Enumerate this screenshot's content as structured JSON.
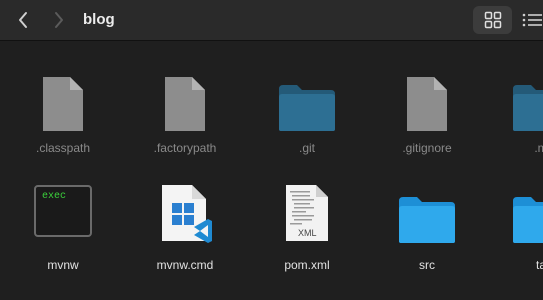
{
  "toolbar": {
    "title": "blog",
    "back_icon": "chevron-left-icon",
    "forward_icon": "chevron-right-icon",
    "grid_view_icon": "grid-view-icon",
    "list_view_icon": "list-view-icon"
  },
  "files": {
    "row1": [
      {
        "name": ".classpath",
        "icon": "document-icon"
      },
      {
        "name": ".factorypath",
        "icon": "document-icon"
      },
      {
        "name": ".git",
        "icon": "folder-icon"
      },
      {
        "name": ".gitignore",
        "icon": "document-icon"
      },
      {
        "name": ".m",
        "icon": "folder-icon"
      }
    ],
    "row2": [
      {
        "name": "mvnw",
        "icon": "terminal-exec-icon",
        "badge_text": "exec"
      },
      {
        "name": "mvnw.cmd",
        "icon": "vscode-file-icon"
      },
      {
        "name": "pom.xml",
        "icon": "xml-file-icon",
        "badge_text": "XML"
      },
      {
        "name": "src",
        "icon": "folder-icon"
      },
      {
        "name": "ta",
        "icon": "folder-icon"
      }
    ]
  },
  "colors": {
    "hidden_folder": "#2d6f93",
    "folder": "#2fa9ec",
    "doc_gray": "#8d8d8d",
    "exec_green": "#3bd13b"
  }
}
